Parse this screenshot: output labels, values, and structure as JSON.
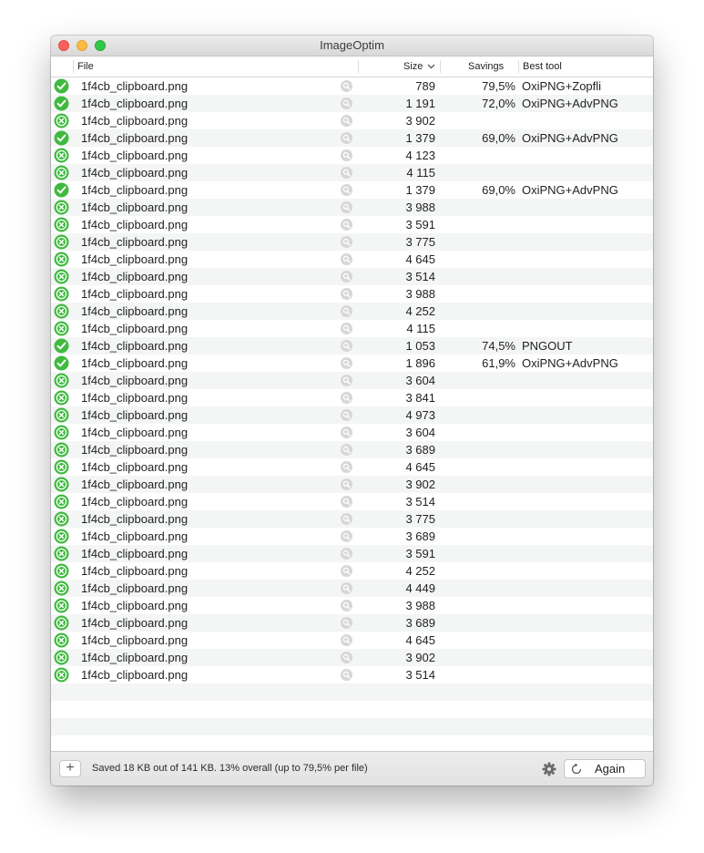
{
  "window": {
    "title": "ImageOptim"
  },
  "columns": {
    "file": "File",
    "size": "Size",
    "savings": "Savings",
    "best_tool": "Best tool"
  },
  "icons": {
    "success": "check-circle-icon",
    "failure": "x-circle-icon",
    "reveal": "magnifier-icon",
    "sort": "chevron-down-icon",
    "add": "plus-icon",
    "settings": "gear-icon",
    "again": "refresh-icon"
  },
  "colors": {
    "status_green": "#3fba3f",
    "row_alt": "#f4f5f5"
  },
  "rows": [
    {
      "status": "ok",
      "file": "1f4cb_clipboard.png",
      "size": "789",
      "savings": "79,5%",
      "tool": "OxiPNG+Zopfli"
    },
    {
      "status": "ok",
      "file": "1f4cb_clipboard.png",
      "size": "1 191",
      "savings": "72,0%",
      "tool": "OxiPNG+AdvPNG"
    },
    {
      "status": "fail",
      "file": "1f4cb_clipboard.png",
      "size": "3 902",
      "savings": "",
      "tool": ""
    },
    {
      "status": "ok",
      "file": "1f4cb_clipboard.png",
      "size": "1 379",
      "savings": "69,0%",
      "tool": "OxiPNG+AdvPNG"
    },
    {
      "status": "fail",
      "file": "1f4cb_clipboard.png",
      "size": "4 123",
      "savings": "",
      "tool": ""
    },
    {
      "status": "fail",
      "file": "1f4cb_clipboard.png",
      "size": "4 115",
      "savings": "",
      "tool": ""
    },
    {
      "status": "ok",
      "file": "1f4cb_clipboard.png",
      "size": "1 379",
      "savings": "69,0%",
      "tool": "OxiPNG+AdvPNG"
    },
    {
      "status": "fail",
      "file": "1f4cb_clipboard.png",
      "size": "3 988",
      "savings": "",
      "tool": ""
    },
    {
      "status": "fail",
      "file": "1f4cb_clipboard.png",
      "size": "3 591",
      "savings": "",
      "tool": ""
    },
    {
      "status": "fail",
      "file": "1f4cb_clipboard.png",
      "size": "3 775",
      "savings": "",
      "tool": ""
    },
    {
      "status": "fail",
      "file": "1f4cb_clipboard.png",
      "size": "4 645",
      "savings": "",
      "tool": ""
    },
    {
      "status": "fail",
      "file": "1f4cb_clipboard.png",
      "size": "3 514",
      "savings": "",
      "tool": ""
    },
    {
      "status": "fail",
      "file": "1f4cb_clipboard.png",
      "size": "3 988",
      "savings": "",
      "tool": ""
    },
    {
      "status": "fail",
      "file": "1f4cb_clipboard.png",
      "size": "4 252",
      "savings": "",
      "tool": ""
    },
    {
      "status": "fail",
      "file": "1f4cb_clipboard.png",
      "size": "4 115",
      "savings": "",
      "tool": ""
    },
    {
      "status": "ok",
      "file": "1f4cb_clipboard.png",
      "size": "1 053",
      "savings": "74,5%",
      "tool": "PNGOUT"
    },
    {
      "status": "ok",
      "file": "1f4cb_clipboard.png",
      "size": "1 896",
      "savings": "61,9%",
      "tool": "OxiPNG+AdvPNG"
    },
    {
      "status": "fail",
      "file": "1f4cb_clipboard.png",
      "size": "3 604",
      "savings": "",
      "tool": ""
    },
    {
      "status": "fail",
      "file": "1f4cb_clipboard.png",
      "size": "3 841",
      "savings": "",
      "tool": ""
    },
    {
      "status": "fail",
      "file": "1f4cb_clipboard.png",
      "size": "4 973",
      "savings": "",
      "tool": ""
    },
    {
      "status": "fail",
      "file": "1f4cb_clipboard.png",
      "size": "3 604",
      "savings": "",
      "tool": ""
    },
    {
      "status": "fail",
      "file": "1f4cb_clipboard.png",
      "size": "3 689",
      "savings": "",
      "tool": ""
    },
    {
      "status": "fail",
      "file": "1f4cb_clipboard.png",
      "size": "4 645",
      "savings": "",
      "tool": ""
    },
    {
      "status": "fail",
      "file": "1f4cb_clipboard.png",
      "size": "3 902",
      "savings": "",
      "tool": ""
    },
    {
      "status": "fail",
      "file": "1f4cb_clipboard.png",
      "size": "3 514",
      "savings": "",
      "tool": ""
    },
    {
      "status": "fail",
      "file": "1f4cb_clipboard.png",
      "size": "3 775",
      "savings": "",
      "tool": ""
    },
    {
      "status": "fail",
      "file": "1f4cb_clipboard.png",
      "size": "3 689",
      "savings": "",
      "tool": ""
    },
    {
      "status": "fail",
      "file": "1f4cb_clipboard.png",
      "size": "3 591",
      "savings": "",
      "tool": ""
    },
    {
      "status": "fail",
      "file": "1f4cb_clipboard.png",
      "size": "4 252",
      "savings": "",
      "tool": ""
    },
    {
      "status": "fail",
      "file": "1f4cb_clipboard.png",
      "size": "4 449",
      "savings": "",
      "tool": ""
    },
    {
      "status": "fail",
      "file": "1f4cb_clipboard.png",
      "size": "3 988",
      "savings": "",
      "tool": ""
    },
    {
      "status": "fail",
      "file": "1f4cb_clipboard.png",
      "size": "3 689",
      "savings": "",
      "tool": ""
    },
    {
      "status": "fail",
      "file": "1f4cb_clipboard.png",
      "size": "4 645",
      "savings": "",
      "tool": ""
    },
    {
      "status": "fail",
      "file": "1f4cb_clipboard.png",
      "size": "3 902",
      "savings": "",
      "tool": ""
    },
    {
      "status": "fail",
      "file": "1f4cb_clipboard.png",
      "size": "3 514",
      "savings": "",
      "tool": ""
    }
  ],
  "footer": {
    "status_text": "Saved 18 KB out of 141 KB. 13% overall (up to 79,5% per file)",
    "again_label": "Again"
  }
}
